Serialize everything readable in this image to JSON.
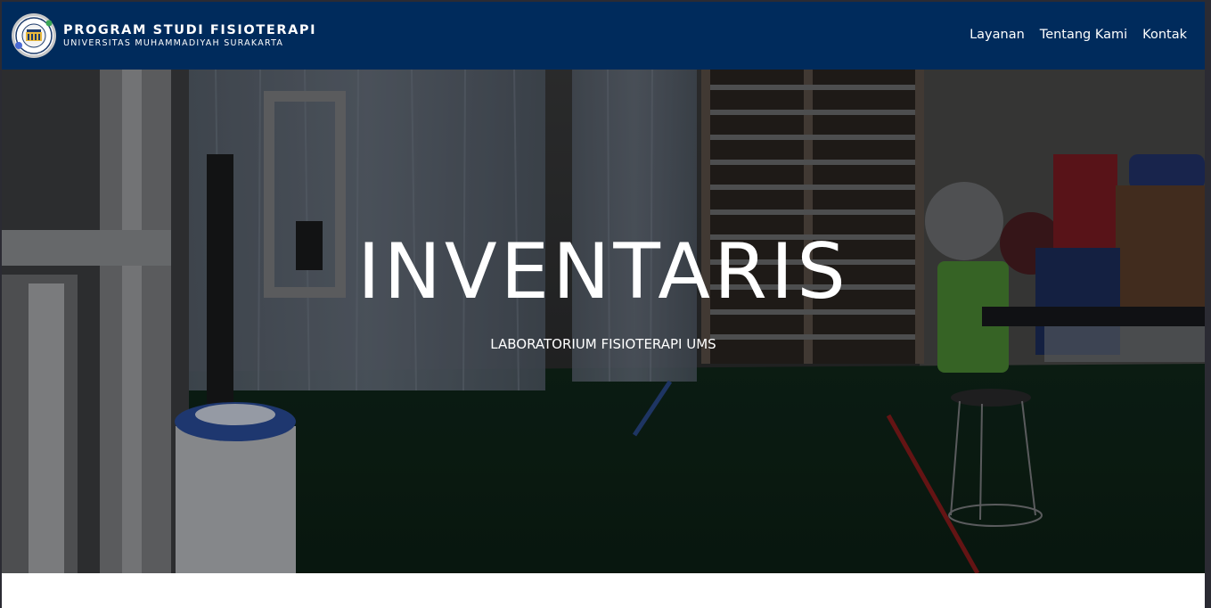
{
  "brand": {
    "title": "PROGRAM STUDI FISIOTERAPI",
    "subtitle": "UNIVERSITAS MUHAMMADIYAH SURAKARTA",
    "logo_icon": "fisioterapi-ums-logo"
  },
  "nav": {
    "items": [
      {
        "label": "Layanan"
      },
      {
        "label": "Tentang Kami"
      },
      {
        "label": "Kontak"
      }
    ]
  },
  "hero": {
    "title": "INVENTARIS",
    "subtitle": "LABORATORIUM FISIOTERAPI UMS",
    "background": "physiotherapy-lab-photo"
  },
  "colors": {
    "navbar": "#002b5c",
    "text": "#ffffff",
    "page_bg": "#ffffff"
  }
}
